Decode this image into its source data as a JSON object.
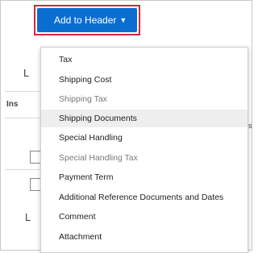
{
  "toolbar": {
    "add_to_header_label": "Add to Header",
    "add_to_header_caret": "▼",
    "highlight_color": "#d6263a",
    "button_color": "#0a6ed1"
  },
  "background": {
    "frag_l1": "L",
    "frag_ins": "Ins",
    "frag_s": "s",
    "frag_l2": "L"
  },
  "menu": {
    "items": [
      {
        "label": "Tax",
        "state": "normal"
      },
      {
        "label": "Shipping Cost",
        "state": "normal"
      },
      {
        "label": "Shipping Tax",
        "state": "muted"
      },
      {
        "label": "Shipping Documents",
        "state": "hover"
      },
      {
        "label": "Special Handling",
        "state": "normal"
      },
      {
        "label": "Special Handling Tax",
        "state": "muted"
      },
      {
        "label": "Payment Term",
        "state": "normal"
      },
      {
        "label": "Additional Reference Documents and Dates",
        "state": "normal"
      },
      {
        "label": "Comment",
        "state": "normal"
      },
      {
        "label": "Attachment",
        "state": "normal"
      }
    ]
  }
}
